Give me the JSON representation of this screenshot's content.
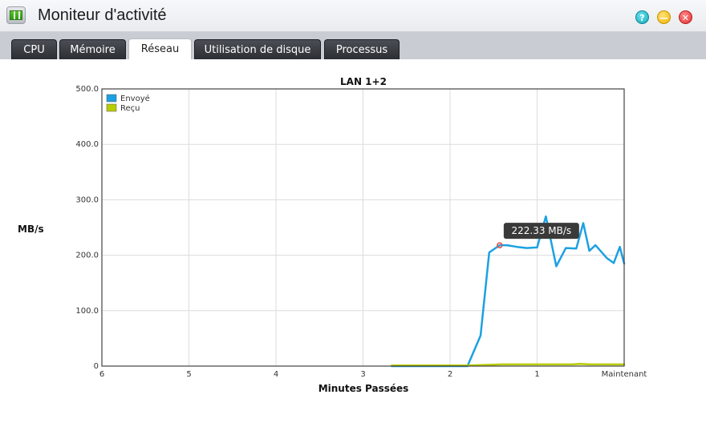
{
  "window": {
    "title": "Moniteur d'activité",
    "help_glyph": "?",
    "min_glyph": "—",
    "close_glyph": "✕"
  },
  "tabs": [
    {
      "label": "CPU"
    },
    {
      "label": "Mémoire"
    },
    {
      "label": "Réseau"
    },
    {
      "label": "Utilisation de disque"
    },
    {
      "label": "Processus"
    }
  ],
  "active_tab": "Réseau",
  "colors": {
    "envoye": "#1ba1e2",
    "recu": "#b8cc00",
    "marker": "#e2504c",
    "tooltip_bg": "#3a3a3a"
  },
  "chart_data": {
    "type": "line",
    "title": "LAN 1+2",
    "xlabel": "Minutes Passées",
    "ylabel": "MB/s",
    "ylim": [
      0,
      500
    ],
    "yticks": [
      {
        "value": 0,
        "label": "0"
      },
      {
        "value": 100,
        "label": "100.0"
      },
      {
        "value": 200,
        "label": "200.0"
      },
      {
        "value": 300,
        "label": "300.0"
      },
      {
        "value": 400,
        "label": "400.0"
      },
      {
        "value": 500,
        "label": "500.0"
      }
    ],
    "xlim": [
      6,
      0
    ],
    "xticks": [
      {
        "value": 6,
        "label": "6"
      },
      {
        "value": 5,
        "label": "5"
      },
      {
        "value": 4,
        "label": "4"
      },
      {
        "value": 3,
        "label": "3"
      },
      {
        "value": 2,
        "label": "2"
      },
      {
        "value": 1,
        "label": "1"
      },
      {
        "value": 0,
        "label": "Maintenant"
      }
    ],
    "grid": true,
    "legend_position": "top-left",
    "series": [
      {
        "name": "Envoyé",
        "color": "#1ba1e2",
        "x": [
          2.67,
          1.8,
          1.65,
          1.55,
          1.43,
          1.35,
          1.23,
          1.12,
          1.0,
          0.9,
          0.78,
          0.67,
          0.55,
          0.47,
          0.4,
          0.33,
          0.2,
          0.12,
          0.05,
          0.0
        ],
        "y": [
          0,
          0,
          55,
          205,
          218,
          218,
          215,
          213,
          214,
          270,
          180,
          213,
          212,
          258,
          208,
          218,
          195,
          186,
          215,
          185
        ]
      },
      {
        "name": "Reçu",
        "color": "#b8cc00",
        "x": [
          2.67,
          1.8,
          1.6,
          1.4,
          1.2,
          1.0,
          0.8,
          0.6,
          0.5,
          0.4,
          0.2,
          0.0
        ],
        "y": [
          1,
          1,
          2,
          3,
          3,
          3,
          3,
          3,
          4,
          3,
          3,
          3
        ]
      }
    ],
    "tooltip": {
      "x": 1.43,
      "y": 218,
      "text": "222.33 MB/s"
    }
  }
}
